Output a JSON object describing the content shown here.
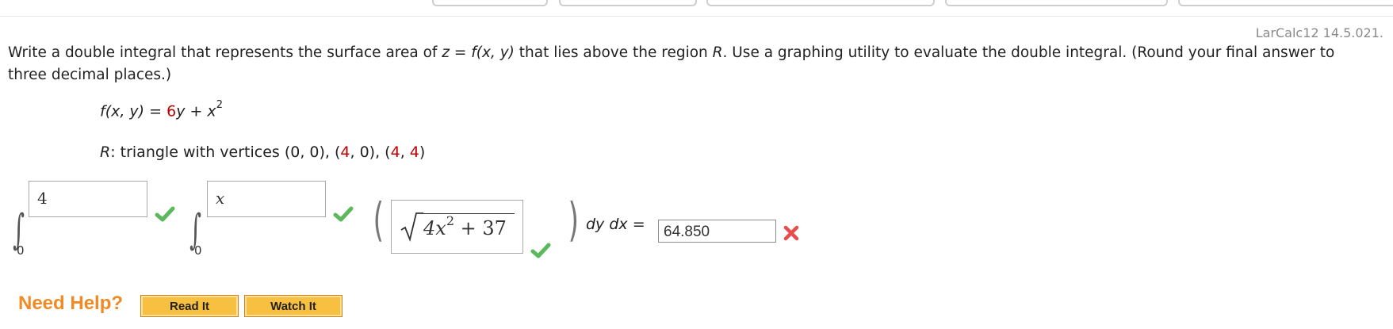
{
  "reference": "LarCalc12 14.5.021.",
  "question": {
    "part1": "Write a double integral that represents the surface area of ",
    "z": "z",
    "eq1": " = ",
    "f": "f",
    "args": "(x, y)",
    "part2": " that lies above the region ",
    "R": "R",
    "part3": ". Use a graphing utility to evaluate the double integral. (Round your final answer to three decimal places.)"
  },
  "function": {
    "lhs": "f(x, y) = ",
    "coef": "6",
    "y": "y + x",
    "exp": "2"
  },
  "region": {
    "R": "R",
    "text": ": triangle with vertices (0, 0), (",
    "v1": "4",
    "mid": ", 0), (",
    "v2": "4",
    "comma": ", ",
    "v3": "4",
    "end": ")"
  },
  "integral": {
    "outer_upper": "4",
    "outer_lower": "0",
    "inner_upper": "x",
    "inner_lower": "0",
    "integrand_sqrt": "√",
    "integrand": "4x",
    "integrand_exp": "2",
    "integrand_tail": " + 37",
    "dydx": "dy dx",
    "equals": " = ",
    "answer": "64.850"
  },
  "status": {
    "outer_upper": "correct",
    "inner_upper": "correct",
    "integrand": "correct",
    "answer": "incorrect"
  },
  "help": {
    "label": "Need Help?",
    "read_it": "Read It",
    "watch_it": "Watch It"
  },
  "colors": {
    "accent_orange": "#f08a24",
    "check_green": "#5cb85c",
    "cross_red": "#e84c4c",
    "value_red": "#c00000"
  }
}
